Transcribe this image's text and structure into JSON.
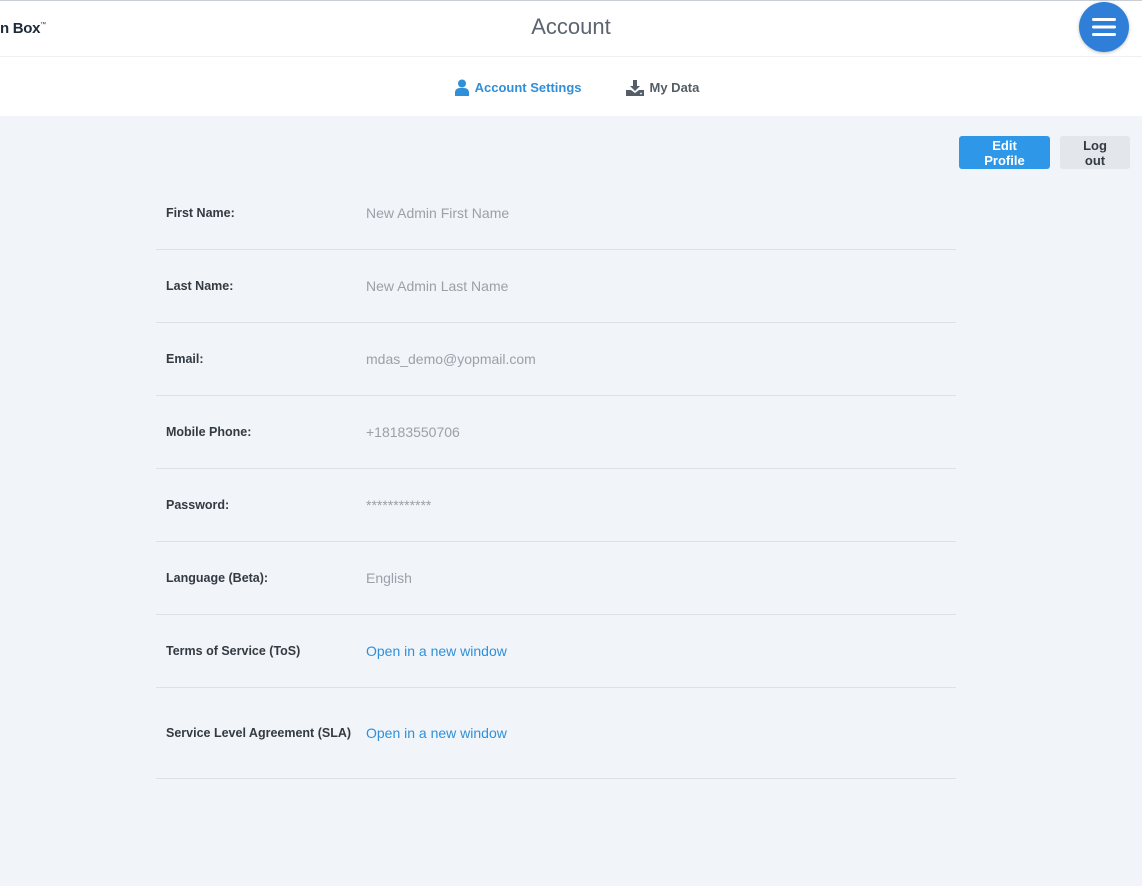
{
  "header": {
    "brand": "n Box",
    "brand_mark": "™",
    "title": "Account"
  },
  "tabs": [
    {
      "label": "Account Settings",
      "icon": "user-icon",
      "active": true
    },
    {
      "label": "My Data",
      "icon": "download-icon",
      "active": false
    }
  ],
  "toolbar": {
    "edit_label": "Edit Profile",
    "logout_label": "Log out"
  },
  "profile": {
    "rows": [
      {
        "label": "First Name:",
        "value": "New Admin First Name"
      },
      {
        "label": "Last Name:",
        "value": "New Admin Last Name"
      },
      {
        "label": "Email:",
        "value": "mdas_demo@yopmail.com"
      },
      {
        "label": "Mobile Phone:",
        "value": "+18183550706"
      },
      {
        "label": "Password:",
        "value": "************"
      },
      {
        "label": "Language (Beta):",
        "value": "English"
      },
      {
        "label": "Terms of Service (ToS)",
        "value": "Open in a new window"
      },
      {
        "label": "Service Level Agreement (SLA)",
        "value": "Open in a new window"
      }
    ]
  },
  "colors": {
    "accent": "#2f97e8",
    "menu_button": "#2f7fd9",
    "background": "#f1f4f8"
  }
}
